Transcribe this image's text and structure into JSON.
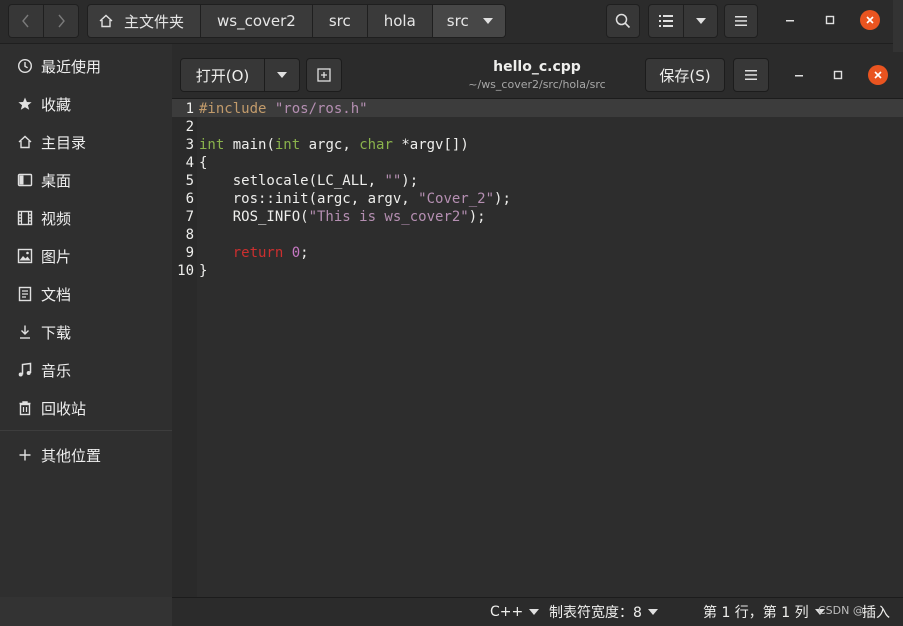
{
  "file_manager": {
    "breadcrumbs": [
      "主文件夹",
      "ws_cover2",
      "src",
      "hola",
      "src"
    ],
    "sidebar": [
      {
        "label": "最近使用",
        "icon": "clock-icon"
      },
      {
        "label": "收藏",
        "icon": "star-icon"
      },
      {
        "label": "主目录",
        "icon": "home-icon"
      },
      {
        "label": "桌面",
        "icon": "desktop-icon"
      },
      {
        "label": "视频",
        "icon": "video-icon"
      },
      {
        "label": "图片",
        "icon": "picture-icon"
      },
      {
        "label": "文档",
        "icon": "document-icon"
      },
      {
        "label": "下载",
        "icon": "download-icon"
      },
      {
        "label": "音乐",
        "icon": "music-icon"
      },
      {
        "label": "回收站",
        "icon": "trash-icon"
      },
      {
        "label": "其他位置",
        "icon": "plus-icon"
      }
    ]
  },
  "editor": {
    "open_label": "打开(O)",
    "title": "hello_c.cpp",
    "path": "~/ws_cover2/src/hola/src",
    "save_label": "保存(S)",
    "line_numbers": [
      "1",
      "2",
      "3",
      "4",
      "5",
      "6",
      "7",
      "8",
      "9",
      "10"
    ],
    "code": {
      "l1a": "#include ",
      "l1b": "\"ros/ros.h\"",
      "l3a": "int",
      "l3b": " main(",
      "l3c": "int",
      "l3d": " argc, ",
      "l3e": "char",
      "l3f": " *argv[])",
      "l4": "{",
      "l5a": "    setlocale(LC_ALL, ",
      "l5b": "\"\"",
      "l5c": ");",
      "l6a": "    ros::init(argc, argv, ",
      "l6b": "\"Cover_2\"",
      "l6c": ");",
      "l7a": "    ROS_INFO(",
      "l7b": "\"This is ws_cover2\"",
      "l7c": ");",
      "l9a": "    ",
      "l9b": "return",
      "l9c": " ",
      "l9d": "0",
      "l9e": ";",
      "l10": "}"
    },
    "status": {
      "language": "C++",
      "tab_width": "制表符宽度：8",
      "position": "第 1 行，第 1 列",
      "mode": "插入",
      "watermark": "CSDN @"
    }
  },
  "colors": {
    "accent_close": "#e95420",
    "keyword": "#cc2f2f",
    "type": "#8ab34c",
    "string": "#b58fb2",
    "preprocessor": "#c29b6b"
  }
}
